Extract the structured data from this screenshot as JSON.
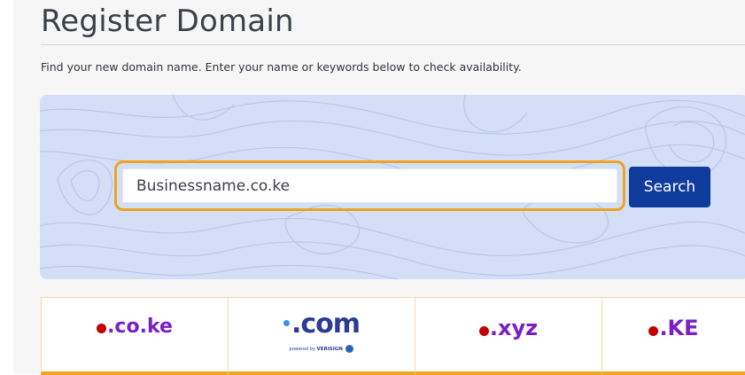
{
  "page": {
    "title": "Register Domain",
    "intro": "Find your new domain name. Enter your name or keywords below to check availability."
  },
  "search": {
    "value": "Businessname.co.ke",
    "button_label": "Search"
  },
  "tlds": [
    {
      "label": ".co.ke"
    },
    {
      "label": ".com",
      "sublabel": "powered by",
      "brand": "VERISIGN"
    },
    {
      "label": ".xyz"
    },
    {
      "label": ".KE"
    }
  ],
  "colors": {
    "accent_border": "#f0a31c",
    "button_bg": "#0f3c9c",
    "hero_bg": "#d3def7",
    "tld_text": "#7b1fc7",
    "tld_dot": "#c00000"
  }
}
